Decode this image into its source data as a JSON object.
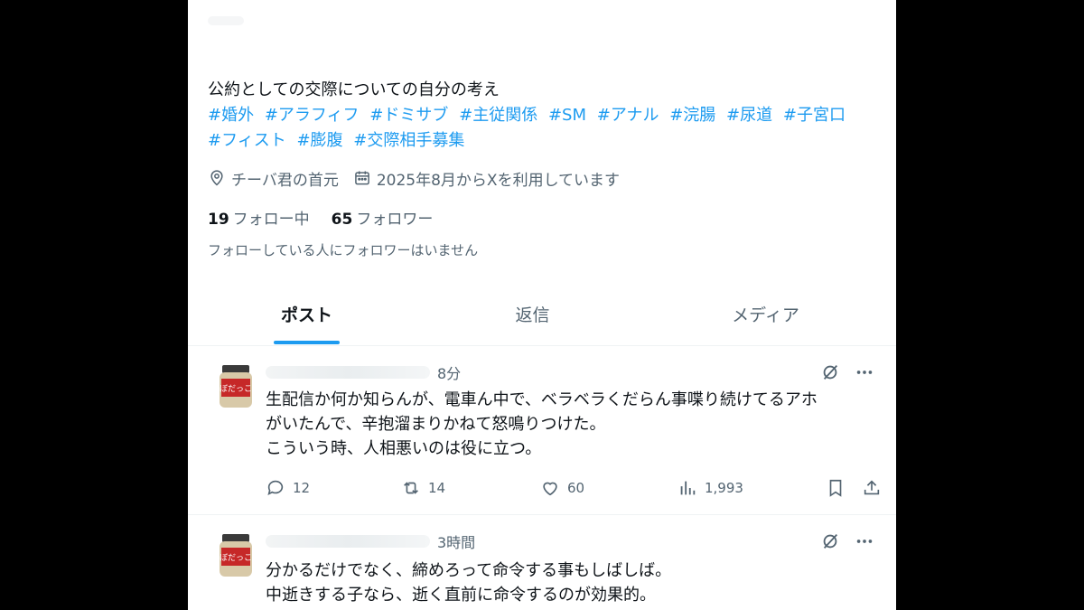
{
  "profile": {
    "bio": "公約としての交際についての自分の考え",
    "hashtags": [
      "#婚外",
      "#アラフィフ",
      "#ドミサブ",
      "#主従関係",
      "#SM",
      "#アナル",
      "#浣腸",
      "#尿道",
      "#子宮口",
      "#フィスト",
      "#膨腹",
      "#交際相手募集"
    ],
    "location": "チーバ君の首元",
    "joined": "2025年8月からXを利用しています",
    "following_count": "19",
    "following_label": "フォロー中",
    "followers_count": "65",
    "followers_label": "フォロワー",
    "no_followers_you_know": "フォローしている人にフォロワーはいません"
  },
  "tabs": [
    {
      "label": "ポスト",
      "active": true
    },
    {
      "label": "返信",
      "active": false
    },
    {
      "label": "メディア",
      "active": false
    }
  ],
  "posts": [
    {
      "time": "8分",
      "lines": [
        "生配信か何か知らんが、電車ん中で、ベラベラくだらん事喋り続けてるアホ",
        "がいたんで、辛抱溜まりかねて怒鳴りつけた。",
        "こういう時、人相悪いのは役に立つ。"
      ],
      "replies": "12",
      "reposts": "14",
      "likes": "60",
      "views": "1,993"
    },
    {
      "time": "3時間",
      "lines": [
        "分かるだけでなく、締めろって命令する事もしばしば。",
        "中逝きする子なら、逝く直前に命令するのが効果的。"
      ]
    }
  ],
  "avatar_label": "ぼだっこ",
  "colors": {
    "accent": "#1d9bf0",
    "secondary": "#536471",
    "text": "#0f1419",
    "background": "#000000"
  }
}
